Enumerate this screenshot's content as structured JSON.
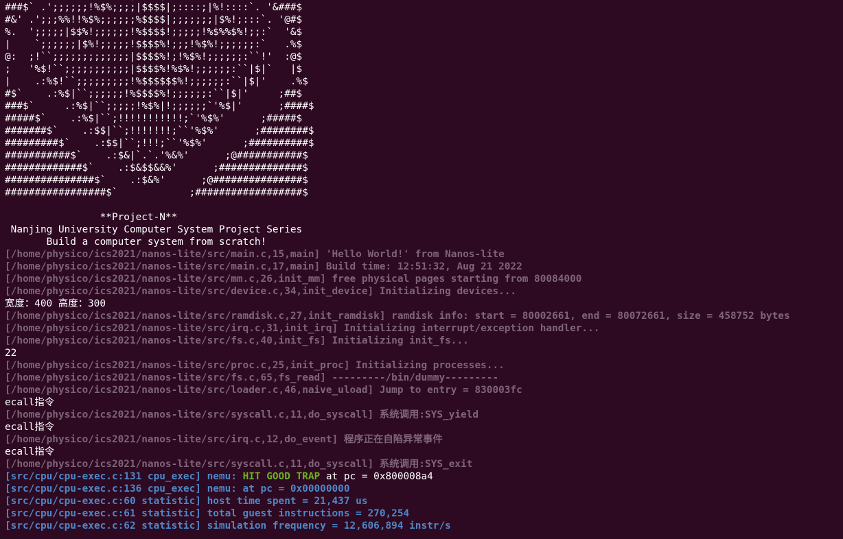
{
  "colors": {
    "background": "#2d0a22",
    "text": "#ffffff",
    "log_gray": "#7f6478",
    "log_blue": "#4f86c6",
    "hit_green": "#6cb31f"
  },
  "terminal": {
    "lines": [
      {
        "segments": [
          {
            "text": "#####$` .`:::::!%$%;:|$$$$|;:::::::::`    &#####$",
            "style": "white"
          }
        ]
      },
      {
        "segments": [
          {
            "text": "###$` .';;;;;;!%$%;;;;|$$$$|;::::;|%!::::`. '&###$",
            "style": "white"
          }
        ]
      },
      {
        "segments": [
          {
            "text": "#&' .';;;%%!!%$%;;;;;;%$$$$|;;;;;;;|$%!;:::`. '@#$",
            "style": "white"
          }
        ]
      },
      {
        "segments": [
          {
            "text": "%.  ';;;;;|$$%!;;;;;;!%$$$$!;;;;;!%$%%$%!;;:`  '&$",
            "style": "white"
          }
        ]
      },
      {
        "segments": [
          {
            "text": "|    `;;;;;;|$%!;;;;;!$$$$%!;;;!%$%!;;;;;;:`   .%$",
            "style": "white"
          }
        ]
      },
      {
        "segments": [
          {
            "text": "@:  ;!``;;;;;;;;;;;;;|$$$$%!;!%$%!;;;;;;:``!'  :@$",
            "style": "white"
          }
        ]
      },
      {
        "segments": [
          {
            "text": ";   '%$!``;;;;;;;;;;;|$$$$%!%$%!;;;;;;:``|$|`   |$",
            "style": "white"
          }
        ]
      },
      {
        "segments": [
          {
            "text": "|    .:%$!``;;;;;;;;;!%$$$$$$%!;;;;;;:``|$|'    .%$",
            "style": "white"
          }
        ]
      },
      {
        "segments": [
          {
            "text": "#$`    .:%$|``;;;;;;!%$$$$%!;;;;;;:``|$|'     ;##$",
            "style": "white"
          }
        ]
      },
      {
        "segments": [
          {
            "text": "###$`     .:%$|``;;;;;!%$%|!;;;;;;`'%$|'      ;####$",
            "style": "white"
          }
        ]
      },
      {
        "segments": [
          {
            "text": "#####$`    .:%$|``;!!!!!!!!!!!;`'%$%'      ;#####$",
            "style": "white"
          }
        ]
      },
      {
        "segments": [
          {
            "text": "#######$`    .:$$|``;!!!!!!!;``'%$%'      ;########$",
            "style": "white"
          }
        ]
      },
      {
        "segments": [
          {
            "text": "#########$`    .:$$|``;!!!;``'%$%'      ;##########$",
            "style": "white"
          }
        ]
      },
      {
        "segments": [
          {
            "text": "###########$`    .:$&|`.`.'%&%'      ;@###########$",
            "style": "white"
          }
        ]
      },
      {
        "segments": [
          {
            "text": "#############$`    .:$&$$&&%'      ;##############$",
            "style": "white"
          }
        ]
      },
      {
        "segments": [
          {
            "text": "###############$`    .:$&%'      ;@###############$",
            "style": "white"
          }
        ]
      },
      {
        "segments": [
          {
            "text": "#################$`            ;##################$",
            "style": "white"
          }
        ]
      },
      {
        "segments": [
          {
            "text": "",
            "style": "white"
          }
        ]
      },
      {
        "segments": [
          {
            "text": "                **Project-N**",
            "style": "white"
          }
        ]
      },
      {
        "segments": [
          {
            "text": " Nanjing University Computer System Project Series",
            "style": "white"
          }
        ]
      },
      {
        "segments": [
          {
            "text": "       Build a computer system from scratch!",
            "style": "white"
          }
        ]
      },
      {
        "segments": [
          {
            "text": "[/home/physico/ics2021/nanos-lite/src/main.c,15,main] 'Hello World!' from Nanos-lite",
            "style": "gray"
          }
        ]
      },
      {
        "segments": [
          {
            "text": "[/home/physico/ics2021/nanos-lite/src/main.c,17,main] Build time: 12:51:32, Aug 21 2022",
            "style": "gray"
          }
        ]
      },
      {
        "segments": [
          {
            "text": "[/home/physico/ics2021/nanos-lite/src/mm.c,26,init_mm] free physical pages starting from 80084000",
            "style": "gray"
          }
        ]
      },
      {
        "segments": [
          {
            "text": "[/home/physico/ics2021/nanos-lite/src/device.c,34,init_device] Initializing devices...",
            "style": "gray"
          }
        ]
      },
      {
        "segments": [
          {
            "text": "宽度：400 高度：300",
            "style": "white"
          }
        ]
      },
      {
        "segments": [
          {
            "text": "[/home/physico/ics2021/nanos-lite/src/ramdisk.c,27,init_ramdisk] ramdisk info: start = 80002661, end = 80072661, size = 458752 bytes",
            "style": "gray"
          }
        ]
      },
      {
        "segments": [
          {
            "text": "[/home/physico/ics2021/nanos-lite/src/irq.c,31,init_irq] Initializing interrupt/exception handler...",
            "style": "gray"
          }
        ]
      },
      {
        "segments": [
          {
            "text": "[/home/physico/ics2021/nanos-lite/src/fs.c,40,init_fs] Initializing init_fs...",
            "style": "gray"
          }
        ]
      },
      {
        "segments": [
          {
            "text": "22",
            "style": "white"
          }
        ]
      },
      {
        "segments": [
          {
            "text": "[/home/physico/ics2021/nanos-lite/src/proc.c,25,init_proc] Initializing processes...",
            "style": "gray"
          }
        ]
      },
      {
        "segments": [
          {
            "text": "[/home/physico/ics2021/nanos-lite/src/fs.c,65,fs_read] ---------/bin/dummy---------",
            "style": "gray"
          }
        ]
      },
      {
        "segments": [
          {
            "text": "[/home/physico/ics2021/nanos-lite/src/loader.c,46,naive_uload] Jump to entry = 830003fc",
            "style": "gray"
          }
        ]
      },
      {
        "segments": [
          {
            "text": "ecall指令",
            "style": "white"
          }
        ]
      },
      {
        "segments": [
          {
            "text": "[/home/physico/ics2021/nanos-lite/src/syscall.c,11,do_syscall] 系统调用:SYS_yield",
            "style": "gray"
          }
        ]
      },
      {
        "segments": [
          {
            "text": "ecall指令",
            "style": "white"
          }
        ]
      },
      {
        "segments": [
          {
            "text": "[/home/physico/ics2021/nanos-lite/src/irq.c,12,do_event] 程序正在自陷异常事件",
            "style": "gray"
          }
        ]
      },
      {
        "segments": [
          {
            "text": "ecall指令",
            "style": "white"
          }
        ]
      },
      {
        "segments": [
          {
            "text": "[/home/physico/ics2021/nanos-lite/src/syscall.c,11,do_syscall] 系统调用:SYS_exit",
            "style": "gray"
          }
        ]
      },
      {
        "segments": [
          {
            "text": "[src/cpu/cpu-exec.c:131 cpu_exec] nemu: ",
            "style": "blue"
          },
          {
            "text": "HIT GOOD TRAP",
            "style": "green"
          },
          {
            "text": " at pc = 0x800008a4",
            "style": "white"
          }
        ]
      },
      {
        "segments": [
          {
            "text": "[src/cpu/cpu-exec.c:136 cpu_exec] nemu: at pc = 0x00000000",
            "style": "blue"
          }
        ]
      },
      {
        "segments": [
          {
            "text": "[src/cpu/cpu-exec.c:60 statistic] host time spent = 21,437 us",
            "style": "blue"
          }
        ]
      },
      {
        "segments": [
          {
            "text": "[src/cpu/cpu-exec.c:61 statistic] total guest instructions = 270,254",
            "style": "blue"
          }
        ]
      },
      {
        "segments": [
          {
            "text": "[src/cpu/cpu-exec.c:62 statistic] simulation frequency = 12,606,894 instr/s",
            "style": "blue"
          }
        ]
      }
    ]
  }
}
